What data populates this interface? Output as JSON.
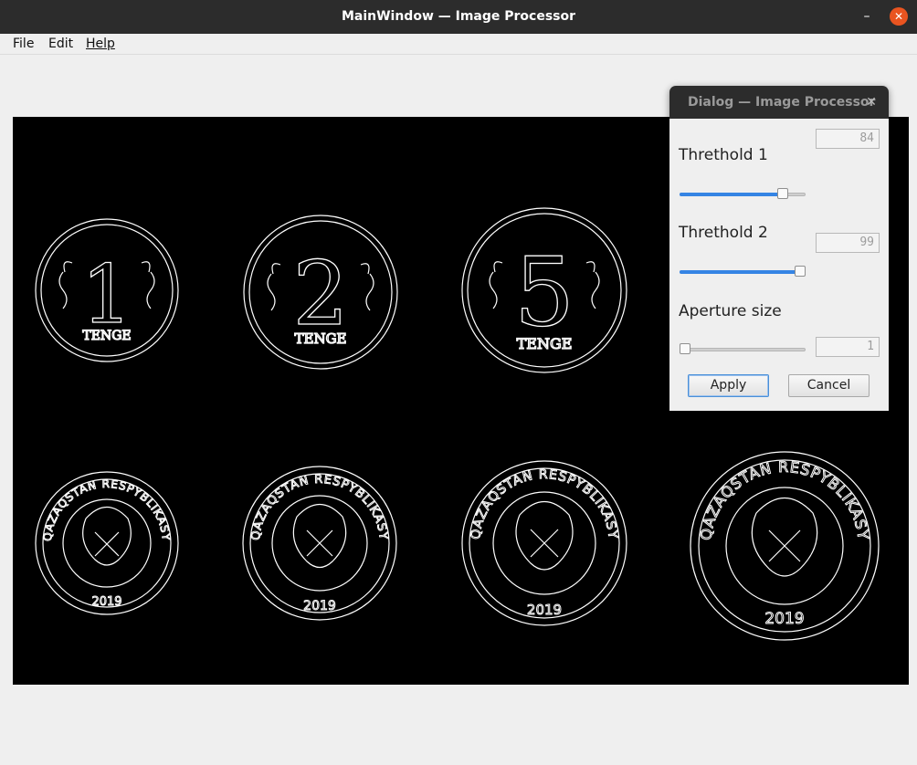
{
  "window": {
    "title": "MainWindow — Image Processor"
  },
  "menu": {
    "file": "File",
    "edit": "Edit",
    "help": "Help"
  },
  "image": {
    "coins_top": [
      {
        "number": "1",
        "label": "TENGE"
      },
      {
        "number": "2",
        "label": "TENGE"
      },
      {
        "number": "5",
        "label": "TENGE"
      }
    ],
    "coins_bottom": [
      {
        "arc": "QAZAQSTAN RESPYBLIKASY",
        "year": "2019"
      },
      {
        "arc": "QAZAQSTAN RESPYBLIKASY",
        "year": "2019"
      },
      {
        "arc": "QAZAQSTAN RESPYBLIKASY",
        "year": "2019"
      },
      {
        "arc": "QAZAQSTAN RESPYBLIKASY",
        "year": "2019"
      }
    ]
  },
  "dialog": {
    "title": "Dialog — Image Processor",
    "threshold1": {
      "label": "Threthold 1",
      "value": "84",
      "fraction": 0.82
    },
    "threshold2": {
      "label": "Threthold 2",
      "value": "99",
      "fraction": 0.97
    },
    "aperture": {
      "label": "Aperture size",
      "value": "1",
      "fraction": 0.0
    },
    "apply": "Apply",
    "cancel": "Cancel"
  },
  "colors": {
    "accent": "#3584e4",
    "close": "#e95420",
    "titlebar": "#2c2c2c"
  },
  "icons": {
    "close": "close-icon",
    "minimize": "minimize-icon",
    "maximize": "maximize-icon"
  }
}
